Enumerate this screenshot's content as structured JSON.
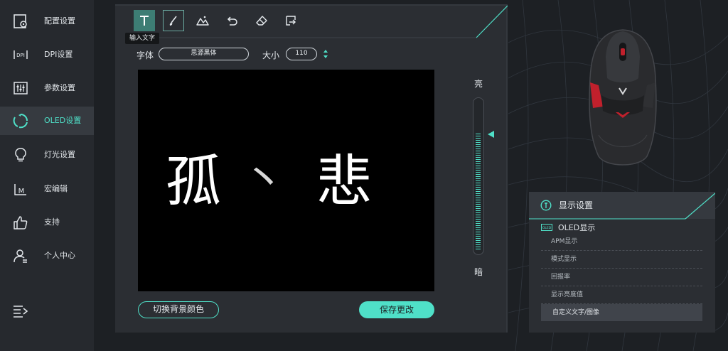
{
  "sidebar": {
    "items": [
      {
        "label": "配置设置",
        "icon": "config-settings-icon"
      },
      {
        "label": "DPI设置",
        "icon": "dpi-icon"
      },
      {
        "label": "参数设置",
        "icon": "parameter-sliders-icon"
      },
      {
        "label": "OLED设置",
        "icon": "oled-refresh-icon"
      },
      {
        "label": "灯光设置",
        "icon": "lightbulb-icon"
      },
      {
        "label": "宏编辑",
        "icon": "macro-icon"
      },
      {
        "label": "支持",
        "icon": "thumbs-up-icon"
      },
      {
        "label": "个人中心",
        "icon": "user-center-icon"
      }
    ],
    "active_index": 3,
    "menu_icon": "menu-expand-icon"
  },
  "editor": {
    "toolbar": {
      "tools": [
        "text-tool-icon",
        "brush-tool-icon",
        "image-tool-icon",
        "undo-icon",
        "eraser-icon",
        "export-icon"
      ],
      "active_tool": "text-tool-icon",
      "tooltip": "输入文字"
    },
    "font_label": "字体",
    "font_value": "思源黑体",
    "size_label": "大小",
    "size_value": "110",
    "canvas_text": [
      "孤",
      "丶",
      "悲"
    ],
    "brightness_high": "亮",
    "brightness_low": "暗",
    "brightness_level_fraction": 0.78,
    "bg_color_button": "切换背景颜色",
    "save_button": "保存更改"
  },
  "display_panel": {
    "title": "显示设置",
    "section_label": "OLED显示",
    "section_icon_text": "OLED",
    "options": [
      "APM显示",
      "模式显示",
      "回报率",
      "显示亮度值",
      "自定义文字/图像"
    ],
    "active_option_index": 4
  },
  "colors": {
    "accent": "#4fe0c8",
    "mouse_accent": "#d0202e",
    "sidebar_bg": "#26292e",
    "panel_bg": "#2b2e33"
  }
}
